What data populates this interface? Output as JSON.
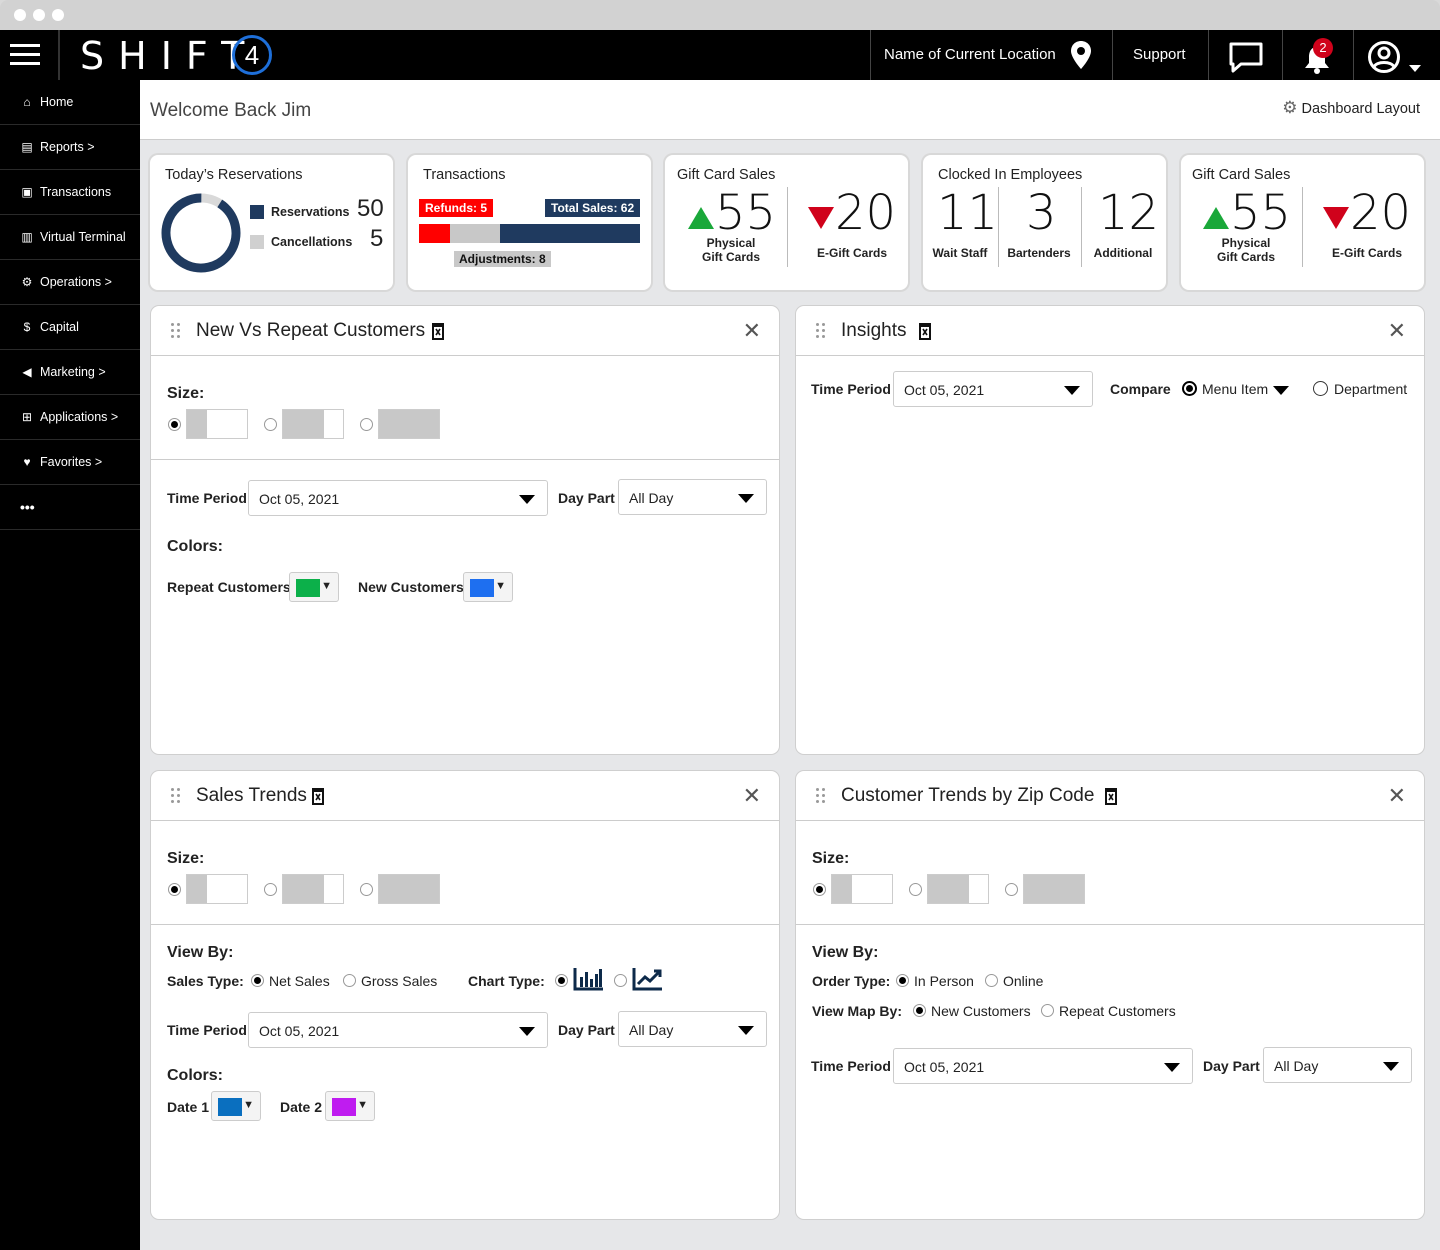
{
  "topbar": {
    "brand": "SHIFT",
    "brand_number": "4",
    "location": "Name of Current Location",
    "support": "Support",
    "notification_count": "2"
  },
  "sidebar": {
    "items": [
      {
        "label": "Home",
        "icon": "home-icon"
      },
      {
        "label": "Reports >",
        "icon": "document-icon"
      },
      {
        "label": "Transactions",
        "icon": "money-icon"
      },
      {
        "label": "Virtual Terminal",
        "icon": "terminal-icon"
      },
      {
        "label": "Operations >",
        "icon": "gear-icon"
      },
      {
        "label": "Capital",
        "icon": "dollar-icon"
      },
      {
        "label": "Marketing >",
        "icon": "megaphone-icon"
      },
      {
        "label": "Applications >",
        "icon": "grid-icon"
      },
      {
        "label": "Favorites >",
        "icon": "heart-icon"
      },
      {
        "label": "•••",
        "icon": "more-icon"
      }
    ]
  },
  "header": {
    "welcome": "Welcome Back Jim",
    "dashboard_layout": "Dashboard Layout"
  },
  "kpis": {
    "reservations": {
      "title": "Today’s Reservations",
      "res_label": "Reservations",
      "res_value": "50",
      "can_label": "Cancellations",
      "can_value": "5",
      "res_fraction": 0.91
    },
    "transactions": {
      "title": "Transactions",
      "refunds": "Refunds: 5",
      "total": "Total Sales: 62",
      "adjustments": "Adjustments: 8"
    },
    "gift1": {
      "title": "Gift Card Sales",
      "physical_value": "55",
      "physical_label": "Physical\nGift Cards",
      "egift_value": "20",
      "egift_label": "E-Gift Cards"
    },
    "employees": {
      "title": "Clocked In Employees",
      "wait_value": "11",
      "wait_label": "Wait Staff",
      "bar_value": "3",
      "bar_label": "Bartenders",
      "add_value": "12",
      "add_label": "Additional"
    },
    "gift2": {
      "title": "Gift Card Sales",
      "physical_value": "55",
      "physical_label": "Physical\nGift Cards",
      "egift_value": "20",
      "egift_label": "E-Gift Cards"
    }
  },
  "panel_nvr": {
    "title": "New Vs Repeat Customers",
    "size_label": "Size:",
    "time_period_label": "Time Period",
    "time_period": "Oct 05, 2021",
    "day_part_label": "Day Part",
    "day_part": "All Day",
    "colors_label": "Colors:",
    "repeat_label": "Repeat Customers",
    "repeat_color": "#0cb04a",
    "new_label": "New Customers",
    "new_color": "#1e6ff0"
  },
  "panel_insights": {
    "title": "Insights",
    "time_period_label": "Time Period",
    "time_period": "Oct 05, 2021",
    "compare_label": "Compare",
    "option_menu": "Menu Item",
    "option_dept": "Department"
  },
  "panel_sales": {
    "title": "Sales Trends",
    "size_label": "Size:",
    "view_by": "View By:",
    "sales_type_label": "Sales Type:",
    "net": "Net Sales",
    "gross": "Gross Sales",
    "chart_type_label": "Chart Type:",
    "time_period_label": "Time Period",
    "time_period": "Oct 05, 2021",
    "day_part_label": "Day Part",
    "day_part": "All Day",
    "colors_label": "Colors:",
    "date1": "Date 1",
    "date1_color": "#0a6fbf",
    "date2": "Date 2",
    "date2_color": "#bf1cf0"
  },
  "panel_zip": {
    "title": "Customer Trends by Zip Code",
    "size_label": "Size:",
    "view_by": "View By:",
    "order_type_label": "Order Type:",
    "in_person": "In Person",
    "online": "Online",
    "map_by_label": "View Map By:",
    "new_customers": "New Customers",
    "repeat_customers": "Repeat Customers",
    "time_period_label": "Time Period",
    "time_period": "Oct 05, 2021",
    "day_part_label": "Day Part",
    "day_part": "All Day"
  }
}
